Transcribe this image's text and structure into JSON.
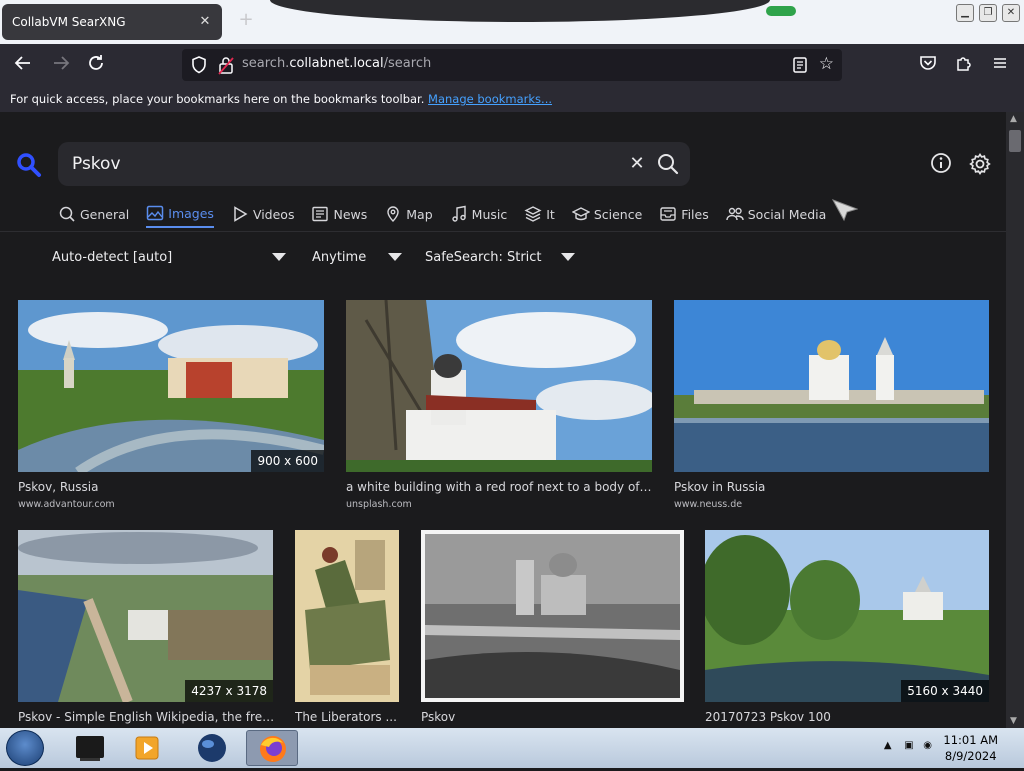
{
  "browser": {
    "tab_title": "CollabVM SearXNG",
    "tab_close": "✕",
    "new_tab": "+",
    "url_prefix": "search.",
    "url_host": "collabnet.local",
    "url_path": "/search",
    "bookmarks_text": "For quick access, place your bookmarks here on the bookmarks toolbar.",
    "bookmarks_link": "Manage bookmarks..."
  },
  "search": {
    "query": "Pskov",
    "clear_glyph": "✕"
  },
  "categories": [
    {
      "label": "General",
      "icon": "search-icon"
    },
    {
      "label": "Images",
      "icon": "image-icon",
      "active": true
    },
    {
      "label": "Videos",
      "icon": "play-icon"
    },
    {
      "label": "News",
      "icon": "newspaper-icon"
    },
    {
      "label": "Map",
      "icon": "map-pin-icon"
    },
    {
      "label": "Music",
      "icon": "music-icon"
    },
    {
      "label": "It",
      "icon": "layers-icon"
    },
    {
      "label": "Science",
      "icon": "school-icon"
    },
    {
      "label": "Files",
      "icon": "file-tray-icon"
    },
    {
      "label": "Social Media",
      "icon": "people-icon"
    }
  ],
  "filters": {
    "language": "Auto-detect [auto]",
    "time": "Anytime",
    "safesearch": "SafeSearch: Strict"
  },
  "results": [
    {
      "title": "Pskov, Russia",
      "url": "www.advantour.com",
      "dims": "900 x 600"
    },
    {
      "title": "a white building with a red roof next to a body of w...",
      "url": "unsplash.com",
      "dims": ""
    },
    {
      "title": "Pskov in Russia",
      "url": "www.neuss.de",
      "dims": ""
    },
    {
      "title": "Pskov - Simple English Wikipedia, the free...",
      "url": "",
      "dims": "4237 x 3178"
    },
    {
      "title": "The Liberators ...",
      "url": "",
      "dims": ""
    },
    {
      "title": "Pskov",
      "url": "",
      "dims": ""
    },
    {
      "title": "20170723 Pskov 100",
      "url": "",
      "dims": "5160 x 3440"
    }
  ],
  "taskbar": {
    "time": "11:01 AM",
    "date": "8/9/2024"
  },
  "colors": {
    "accent": "#5a8dee",
    "page_bg": "#1b1b1d",
    "search_box": "#29292e",
    "link": "#45a1ff"
  }
}
